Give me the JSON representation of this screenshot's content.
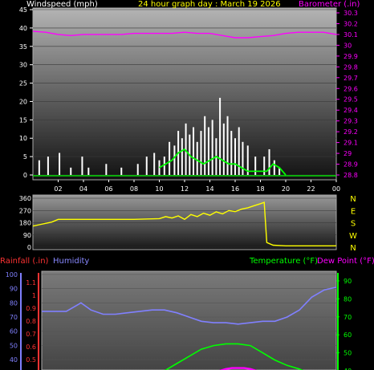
{
  "header": {
    "wind_label": "Windspeed (mph)",
    "graph_title": "24 hour graph day : March 19 2026",
    "baro_label": "Barometer (.in)"
  },
  "colors": {
    "wind_label": "#ffffff",
    "title": "#ffff00",
    "baro": "#ff00ff",
    "direction": "#ffff00",
    "rain": "#ff3333",
    "humidity": "#8080ff",
    "temperature": "#00ff00",
    "dewpoint": "#ff00ff",
    "wind_avg": "#00ff00",
    "wind_gust": "#ffffff"
  },
  "direction_axis": {
    "compass": [
      "N",
      "W",
      "S",
      "E",
      "N"
    ]
  },
  "bottom_header": {
    "rain_label": "Rainfall (.in)",
    "humidity_label": "Humidity",
    "temp_label": "Temperature (°F)",
    "dew_label": "Dew Point (°F)"
  },
  "chart_data": [
    {
      "type": "line",
      "title": "24 hour graph day : March 19 2026",
      "x_ticks": [
        "02",
        "04",
        "06",
        "08",
        "10",
        "12",
        "14",
        "16",
        "18",
        "20",
        "22",
        "00"
      ],
      "y_left_label": "Windspeed (mph)",
      "y_left_ticks": [
        "0",
        "5",
        "10",
        "15",
        "20",
        "25",
        "30",
        "35",
        "40",
        "45"
      ],
      "y_left_lim": [
        0,
        45
      ],
      "y_right_label": "Barometer (.in)",
      "y_right_ticks": [
        "28.8",
        "28.9",
        "29",
        "29.1",
        "29.2",
        "29.3",
        "29.4",
        "29.5",
        "29.6",
        "29.7",
        "29.8",
        "29.9",
        "30",
        "30.1",
        "30.2",
        "30.3"
      ],
      "y_right_lim": [
        28.8,
        30.3
      ],
      "series": [
        {
          "name": "Barometer",
          "axis": "right",
          "x": [
            0,
            1,
            2,
            3,
            4,
            5,
            6,
            7,
            8,
            9,
            10,
            11,
            12,
            13,
            14,
            15,
            16,
            17,
            18,
            19,
            20,
            21,
            22,
            23,
            24
          ],
          "y": [
            30.13,
            30.12,
            30.1,
            30.09,
            30.1,
            30.1,
            30.1,
            30.1,
            30.11,
            30.11,
            30.11,
            30.11,
            30.12,
            30.11,
            30.11,
            30.09,
            30.07,
            30.07,
            30.08,
            30.09,
            30.11,
            30.12,
            30.12,
            30.12,
            30.1
          ]
        },
        {
          "name": "Wind gust",
          "axis": "left",
          "x": [
            0.5,
            1.2,
            2.1,
            3.0,
            3.9,
            4.4,
            5.8,
            7.0,
            8.3,
            9.0,
            9.6,
            10.0,
            10.4,
            10.8,
            11.2,
            11.5,
            11.8,
            12.1,
            12.4,
            12.7,
            13.0,
            13.3,
            13.6,
            13.9,
            14.2,
            14.5,
            14.8,
            15.1,
            15.4,
            15.7,
            16.0,
            16.3,
            16.6,
            17.0,
            17.6,
            18.3,
            18.7,
            19.1,
            19.5,
            20.2,
            21.0,
            22.0,
            23.0
          ],
          "y": [
            4,
            5,
            6,
            2,
            5,
            2,
            3,
            2,
            3,
            5,
            6,
            4,
            5,
            9,
            8,
            12,
            10,
            14,
            11,
            13,
            9,
            12,
            16,
            13,
            15,
            10,
            21,
            14,
            16,
            12,
            10,
            13,
            9,
            8,
            5,
            5,
            7,
            4,
            2,
            0,
            0,
            0,
            0
          ]
        },
        {
          "name": "Wind average",
          "axis": "left",
          "x": [
            10.0,
            10.5,
            11.0,
            11.5,
            12.0,
            12.5,
            13.0,
            13.5,
            14.0,
            14.5,
            15.0,
            15.5,
            16.0,
            16.5,
            17.0,
            18.5,
            19.0,
            19.5,
            20.0
          ],
          "y": [
            2,
            3,
            4,
            6,
            7,
            5,
            4,
            3,
            4,
            5,
            4,
            3,
            3,
            2,
            1,
            1,
            3,
            2,
            0
          ]
        }
      ]
    },
    {
      "type": "line",
      "y_left_ticks": [
        "0",
        "90",
        "180",
        "270",
        "360"
      ],
      "y_lim": [
        0,
        360
      ],
      "y_right_ticks": [
        "N",
        "W",
        "S",
        "E",
        "N"
      ],
      "series": [
        {
          "name": "Wind direction",
          "x": [
            0,
            0.5,
            1.0,
            1.5,
            2.0,
            4.0,
            6.0,
            8.0,
            10.0,
            10.5,
            11.0,
            11.5,
            12.0,
            12.5,
            13.0,
            13.5,
            14.0,
            14.5,
            15.0,
            15.5,
            16.0,
            16.5,
            17.0,
            17.5,
            18.0,
            18.3,
            18.5,
            19.0,
            20.0,
            22.0,
            24.0
          ],
          "y": [
            155,
            165,
            175,
            185,
            205,
            205,
            205,
            205,
            210,
            225,
            215,
            230,
            205,
            240,
            225,
            250,
            235,
            260,
            245,
            270,
            262,
            280,
            290,
            305,
            320,
            330,
            35,
            15,
            10,
            10,
            10
          ]
        }
      ]
    },
    {
      "type": "line",
      "y_humidity_ticks": [
        "40",
        "50",
        "60",
        "70",
        "80",
        "90",
        "100"
      ],
      "y_humidity_lim": [
        40,
        100
      ],
      "y_rain_ticks": [
        "0.5",
        "0.6",
        "0.7",
        "0.8",
        "0.9",
        "1",
        "1.1"
      ],
      "y_rain_lim": [
        0.45,
        1.15
      ],
      "y_temp_ticks": [
        "40",
        "50",
        "60",
        "70",
        "80",
        "90"
      ],
      "y_temp_lim": [
        40,
        90
      ],
      "series": [
        {
          "name": "Humidity",
          "x": [
            0,
            1,
            2,
            2.8,
            3.2,
            4,
            5,
            6,
            7,
            8,
            9,
            10,
            11,
            12,
            13,
            14,
            15,
            16,
            17,
            18,
            19,
            20,
            21,
            22,
            23,
            24
          ],
          "y": [
            74,
            74,
            74,
            78,
            80,
            75,
            72,
            72,
            73,
            74,
            75,
            75,
            73,
            70,
            67,
            66,
            66,
            65,
            66,
            67,
            67,
            70,
            75,
            84,
            89,
            91
          ]
        },
        {
          "name": "Temperature",
          "x": [
            10,
            11,
            12,
            13,
            14,
            15,
            16,
            17,
            18,
            19,
            20,
            21,
            22
          ],
          "y": [
            40,
            44,
            48,
            52,
            54,
            55,
            55,
            54,
            50,
            46,
            43,
            41,
            38
          ]
        },
        {
          "name": "Dew Point",
          "x": [
            14.5,
            15,
            15.5,
            16,
            16.5,
            17,
            17.5
          ],
          "y": [
            40,
            41,
            41.5,
            41.5,
            41.5,
            41,
            40
          ]
        }
      ]
    }
  ]
}
